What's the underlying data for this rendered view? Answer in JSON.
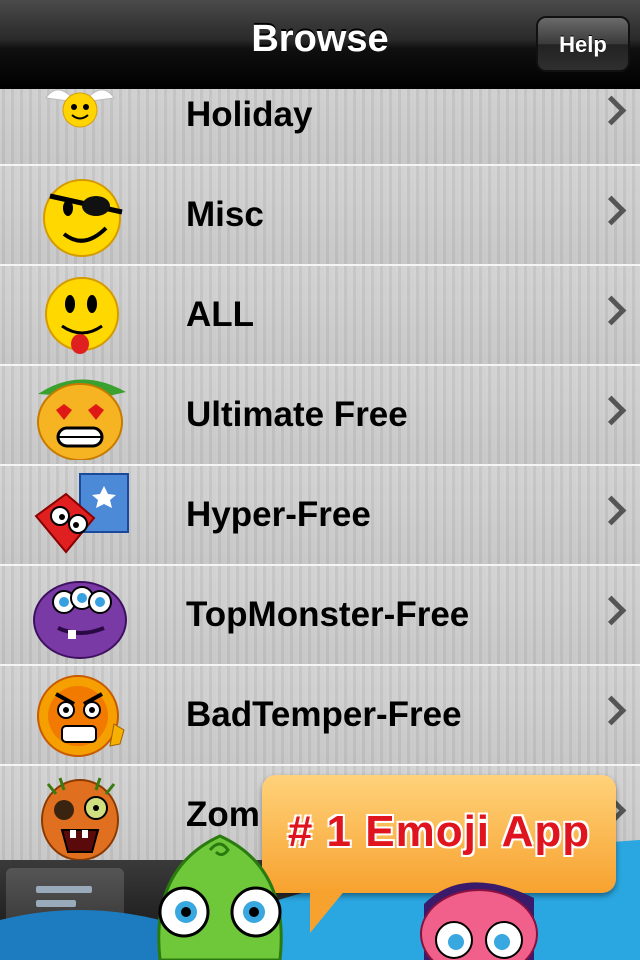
{
  "nav": {
    "title": "Browse",
    "help_label": "Help"
  },
  "list": {
    "items": [
      {
        "label": "Holiday",
        "icon": "angel-smiley-icon"
      },
      {
        "label": "Misc",
        "icon": "pirate-smiley-icon"
      },
      {
        "label": "ALL",
        "icon": "tongue-smiley-icon"
      },
      {
        "label": "Ultimate Free",
        "icon": "heart-eyes-elf-icon"
      },
      {
        "label": "Hyper-Free",
        "icon": "red-cube-monster-icon"
      },
      {
        "label": "TopMonster-Free",
        "icon": "purple-monster-icon"
      },
      {
        "label": "BadTemper-Free",
        "icon": "angry-smiley-icon"
      },
      {
        "label": "Zom",
        "icon": "zombie-smiley-icon"
      }
    ]
  },
  "ad": {
    "text": "# 1 Emoji App"
  }
}
